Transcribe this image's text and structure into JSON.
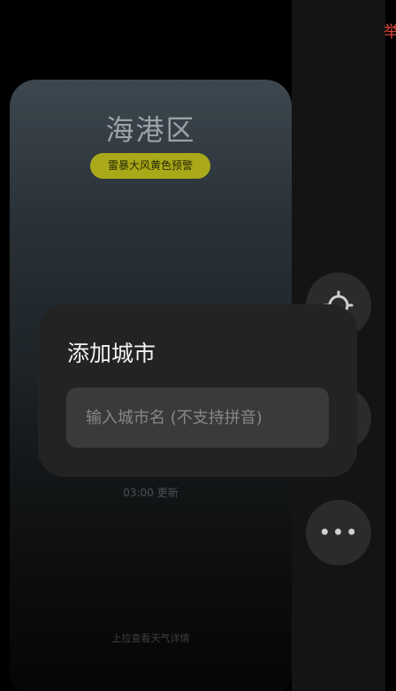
{
  "edge_text": "举",
  "weather_card": {
    "city_name": "海港区",
    "warning_badge": "雷暴大风黄色预警",
    "update_time": "03:00 更新",
    "swipe_hint": "上拉查看天气详情"
  },
  "side_buttons": {
    "locate_icon": "locate-icon",
    "more_icon": "more-dots-icon",
    "more_glyph": "•••"
  },
  "dialog": {
    "title": "添加城市",
    "input_value": "",
    "input_placeholder": "输入城市名 (不支持拼音)"
  },
  "colors": {
    "warning_badge_bg": "#a9a91a",
    "dialog_bg": "#232323",
    "edge_text": "#e0483f"
  }
}
